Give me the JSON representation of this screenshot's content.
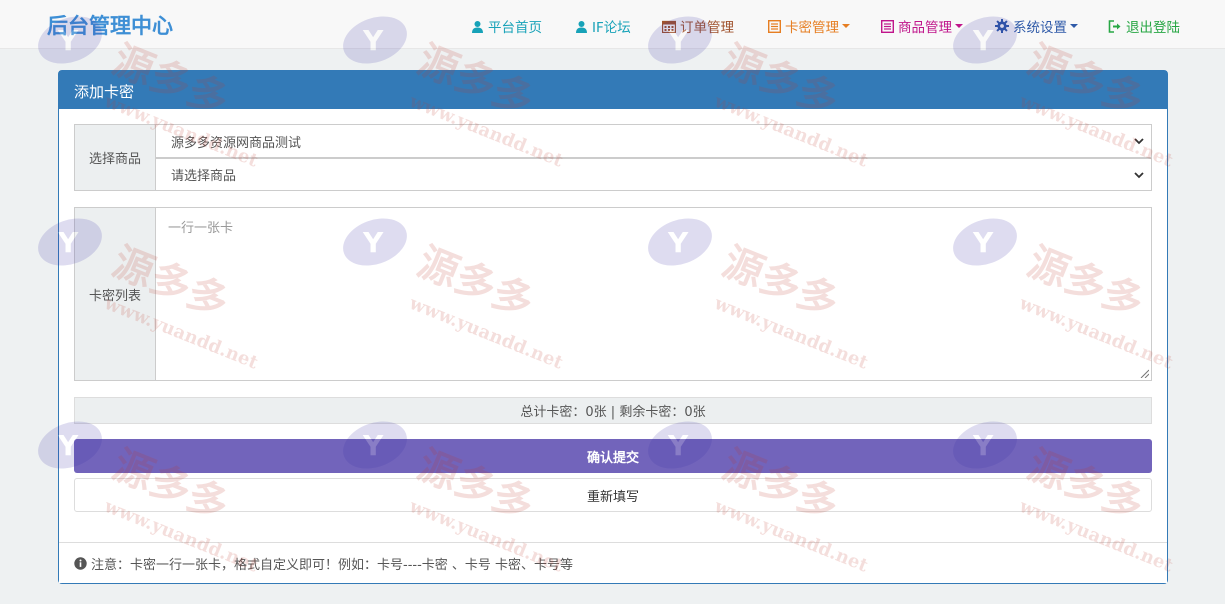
{
  "brand": "后台管理中心",
  "nav": {
    "home": "平台首页",
    "forum": "IF论坛",
    "orders": "订单管理",
    "cards": "卡密管理",
    "products": "商品管理",
    "settings": "系统设置",
    "logout": "退出登陆"
  },
  "colors": {
    "home": "#17a2b8",
    "forum": "#17a2b8",
    "orders": "#a0522d",
    "cards": "#e67e22",
    "products": "#c0158b",
    "settings": "#2f5aa8",
    "logout": "#28a745",
    "panel": "#337ab7",
    "submit": "#7264bb"
  },
  "panel": {
    "title": "添加卡密",
    "select_label": "选择商品",
    "select_category": "源多多资源网商品测试",
    "select_product": "请选择商品",
    "list_label": "卡密列表",
    "textarea_placeholder": "一行一张卡",
    "summary": "总计卡密：0张 | 剩余卡密：0张",
    "submit": "确认提交",
    "reset": "重新填写",
    "note": "注意：卡密一行一张卡，格式自定义即可！例如：卡号----卡密 、卡号 卡密、卡号等"
  },
  "watermark": {
    "brand": "源多多",
    "url": "www.yuandd.net"
  }
}
